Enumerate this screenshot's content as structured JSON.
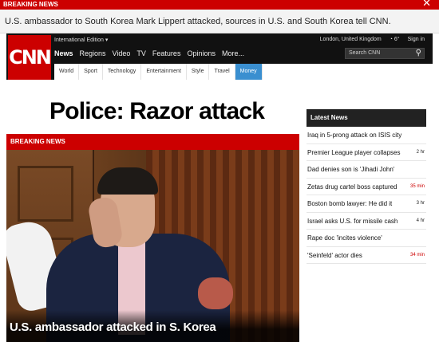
{
  "breaking": {
    "label": "BREAKING NEWS",
    "close": "✕",
    "headline": "U.S. ambassador to South Korea Mark Lippert attacked, sources in U.S. and South Korea tell CNN."
  },
  "header": {
    "logo": "CNN",
    "edition": "International Edition ▾",
    "location": "London, United Kingdom",
    "weather": "◔ 6°",
    "signin": "Sign in",
    "nav": [
      "News",
      "Regions",
      "Video",
      "TV",
      "Features",
      "Opinions",
      "More..."
    ],
    "search_placeholder": "Search CNN",
    "subnav": [
      "World",
      "Sport",
      "Technology",
      "Entertainment",
      "Style",
      "Travel",
      "Money"
    ]
  },
  "main": {
    "headline": "Police: Razor attack",
    "breaking_label": "BREAKING NEWS",
    "photo_caption": "U.S. ambassador attacked in S. Korea"
  },
  "latest": {
    "title": "Latest News",
    "items": [
      {
        "text": "Iraq in 5-prong attack on ISIS city",
        "time": ""
      },
      {
        "text": "Premier League player collapses",
        "time": "2 hr"
      },
      {
        "text": "Dad denies son is 'Jihadi John'",
        "time": ""
      },
      {
        "text": "Zetas drug cartel boss captured",
        "time": "35 min"
      },
      {
        "text": "Boston bomb lawyer: He did it",
        "time": "3 hr"
      },
      {
        "text": "Israel asks U.S. for missile cash",
        "time": "4 hr"
      },
      {
        "text": "Rape doc 'incites violence'",
        "time": ""
      },
      {
        "text": "'Seinfeld' actor dies",
        "time": "34 min"
      }
    ]
  },
  "colors": {
    "brand_red": "#cc0000",
    "header_bg": "#111111",
    "active_tab": "#3a8fd0"
  }
}
